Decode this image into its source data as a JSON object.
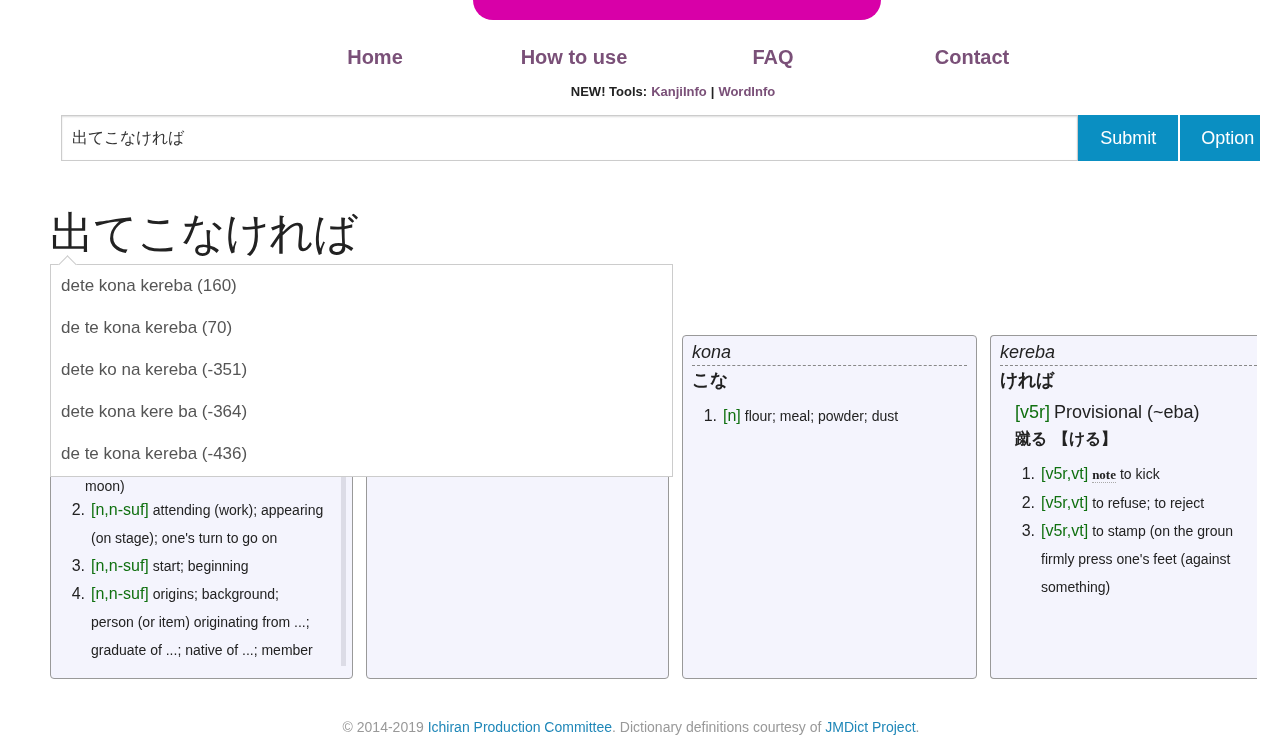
{
  "nav": [
    {
      "label": "Home"
    },
    {
      "label": "How to use"
    },
    {
      "label": "FAQ"
    },
    {
      "label": "Contact"
    }
  ],
  "tools": {
    "prefix": "NEW! Tools:",
    "links": [
      "KanjiInfo",
      "WordInfo"
    ],
    "separator": "|"
  },
  "search": {
    "value": "出てこなければ",
    "buttons": [
      "Submit",
      "Option"
    ]
  },
  "title": "出てこなければ",
  "romanizations": [
    {
      "label": "dete kona kereba (160)"
    },
    {
      "label": "de te kona kereba (70)"
    },
    {
      "label": "dete ko na kereba (-351)"
    },
    {
      "label": "dete kona kere ba (-364)"
    },
    {
      "label": "de te kona kereba (-436)"
    }
  ],
  "cards": [
    {
      "kind": "scrolled",
      "continuation": "moon)",
      "senses": [
        {
          "number": "2.",
          "pos": "[n,n-suf]",
          "gloss": [
            "attending (work); appearing",
            "(on stage); one's turn to go on"
          ]
        },
        {
          "number": "3.",
          "pos": "[n,n-suf]",
          "gloss": [
            "start; beginning"
          ]
        },
        {
          "number": "4.",
          "pos": "[n,n-suf]",
          "gloss": [
            "origins; background;",
            "person (or item) originating from ...;",
            "graduate of ...; native of ...; member"
          ]
        }
      ]
    },
    {
      "kind": "empty"
    },
    {
      "kind": "word",
      "romaji": "kona",
      "kana": "こな",
      "senses": [
        {
          "number": "1.",
          "pos": "[n]",
          "gloss": [
            "flour; meal; powder; dust"
          ]
        }
      ]
    },
    {
      "kind": "conjugated",
      "romaji": "kereba",
      "kana": "ければ",
      "conj_pos": "[v5r]",
      "conj_type": "Provisional (~eba)",
      "base": "蹴る 【ける】",
      "senses": [
        {
          "number": "1.",
          "pos": "[v5r,vt]",
          "note": "note",
          "gloss": [
            "to kick"
          ]
        },
        {
          "number": "2.",
          "pos": "[v5r,vt]",
          "gloss": [
            "to refuse; to reject"
          ]
        },
        {
          "number": "3.",
          "pos": "[v5r,vt]",
          "gloss": [
            "to stamp (on the groun",
            "firmly press one's feet (against",
            "something)"
          ]
        }
      ]
    }
  ],
  "footer": [
    {
      "kind": "text",
      "text": "© 2014-2019 "
    },
    {
      "kind": "link",
      "text": "Ichiran Production Committee"
    },
    {
      "kind": "text",
      "text": ". Dictionary definitions courtesy of "
    },
    {
      "kind": "link",
      "text": "JMDict Project"
    },
    {
      "kind": "text",
      "text": "."
    }
  ]
}
